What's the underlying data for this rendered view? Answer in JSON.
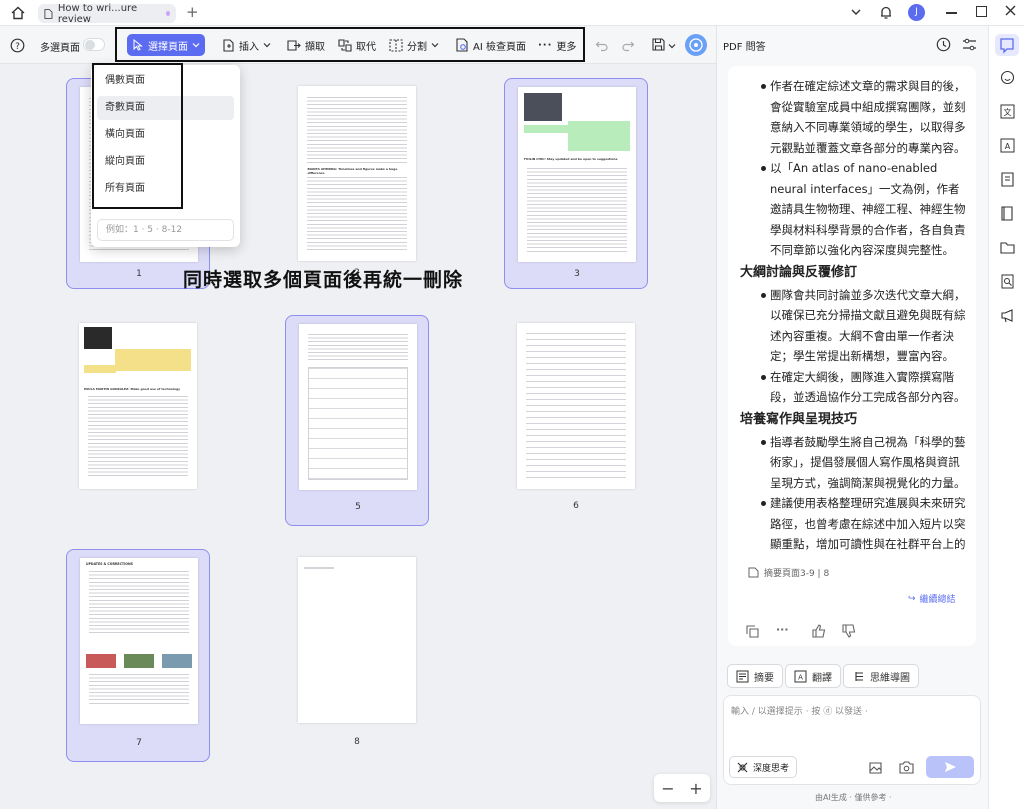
{
  "tab": {
    "title": "How to wri...ure review"
  },
  "toolbar": {
    "multipage_label": "多選頁面",
    "select_page_label": "選擇頁面",
    "insert_label": "插入",
    "extract_label": "擷取",
    "replace_label": "取代",
    "split_label": "分割",
    "ai_check_label": "AI 檢查頁面",
    "more_label": "更多"
  },
  "dropdown": {
    "items": [
      "偶數頁面",
      "奇數頁面",
      "橫向頁面",
      "縱向頁面",
      "所有頁面"
    ],
    "input_placeholder": "例如：1 · 5 · 8-12"
  },
  "caption": "同時選取多個頁面後再統一刪除",
  "pages": [
    {
      "num": "1",
      "selected": true
    },
    {
      "num": "2",
      "selected": false
    },
    {
      "num": "3",
      "selected": true
    },
    {
      "num": "4",
      "selected": false
    },
    {
      "num": "5",
      "selected": true
    },
    {
      "num": "6",
      "selected": false
    },
    {
      "num": "7",
      "selected": true
    },
    {
      "num": "8",
      "selected": false
    }
  ],
  "page2_heading": "BIANTA AHMRNG: Timelines and figures make a huge difference",
  "page3_heading": "FOILIN CHIU: Stay updated and be open to suggestions",
  "page4_heading": "PAULA MARTIN GONZALEZ: Make good use of technology",
  "page7_heading": "UPDATES & CORRECTIONS",
  "page8_text": "",
  "panel": {
    "title": "PDF 問答",
    "paragraphs": [
      {
        "type": "li",
        "text": "作者在確定綜述文章的需求與目的後，會從實驗室成員中組成撰寫團隊，並刻意納入不同專業領域的學生，以取得多元觀點並覆蓋文章各部分的專業內容。"
      },
      {
        "type": "li",
        "text": "以「An atlas of nano-enabled neural interfaces」一文為例，作者邀請具生物物理、神經工程、神經生物學與材料科學背景的合作者，各自負責不同章節以強化內容深度與完整性。"
      },
      {
        "type": "h",
        "text": "大綱討論與反覆修訂"
      },
      {
        "type": "li",
        "text": "團隊會共同討論並多次迭代文章大綱，以確保已充分掃描文獻且避免與既有綜述內容重複。大綱不會由單一作者決定；學生常提出新構想，豐富內容。"
      },
      {
        "type": "li",
        "text": "在確定大綱後，團隊進入實際撰寫階段，並透過協作分工完成各部分內容。"
      },
      {
        "type": "h",
        "text": "培養寫作與呈現技巧"
      },
      {
        "type": "li",
        "text": "指導者鼓勵學生將自己視為「科學的藝術家」，提倡發展個人寫作風格與資訊呈現方式，強調簡潔與視覺化的力量。"
      },
      {
        "type": "li",
        "text": "建議使用表格整理研究進展與未來研究路徑，也曾考慮在綜述中加入短片以突顯重點，增加可讀性與在社群平台上的傳播"
      }
    ],
    "summary_ref": "摘要頁面3-9 | 8",
    "continue_label": "繼續總結",
    "chips": [
      "摘要",
      "翻譯",
      "思維導圖"
    ],
    "input_placeholder": "輸入 / 以選擇提示 · 按 ⓓ 以發送 ·",
    "deep_think_label": "深度思考",
    "footer": "由AI生成 · 僅供參考 ·"
  },
  "colors": {
    "accent": "#5b6cf0",
    "selection": "#dcdcf8",
    "highlight_green": "#9ee3a0",
    "highlight_yellow": "#f3d86b"
  }
}
